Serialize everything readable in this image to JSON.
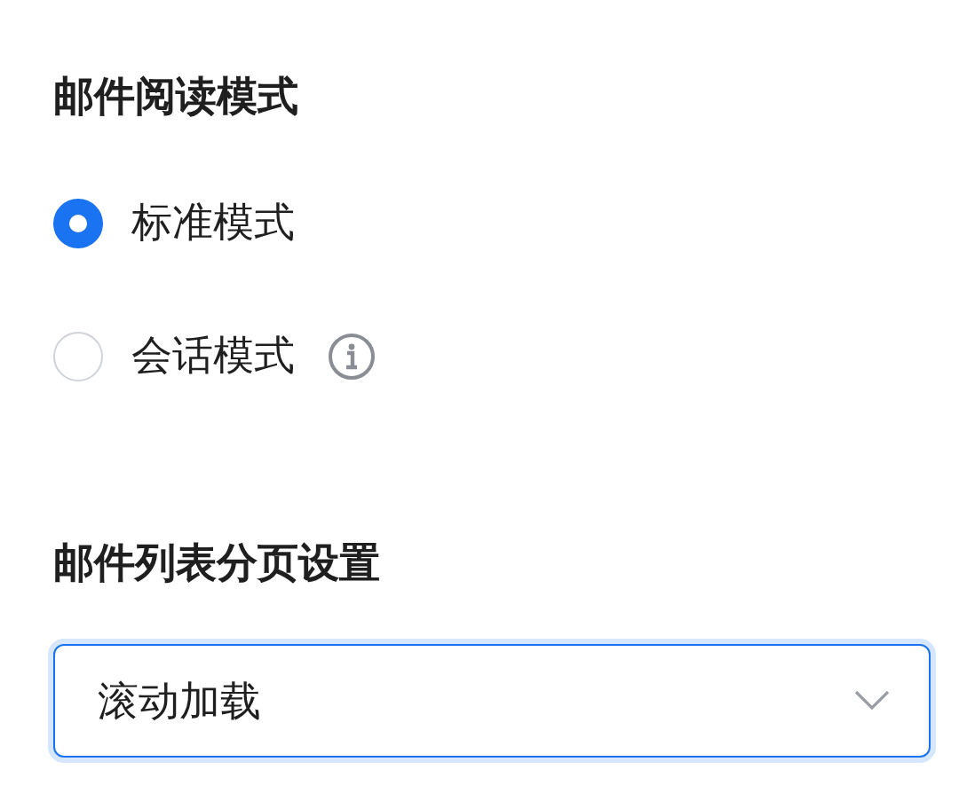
{
  "reading_mode": {
    "title": "邮件阅读模式",
    "options": [
      {
        "label": "标准模式",
        "selected": true,
        "info": false
      },
      {
        "label": "会话模式",
        "selected": false,
        "info": true
      }
    ]
  },
  "pagination": {
    "title": "邮件列表分页设置",
    "select": {
      "value": "滚动加载",
      "focused": true
    }
  }
}
